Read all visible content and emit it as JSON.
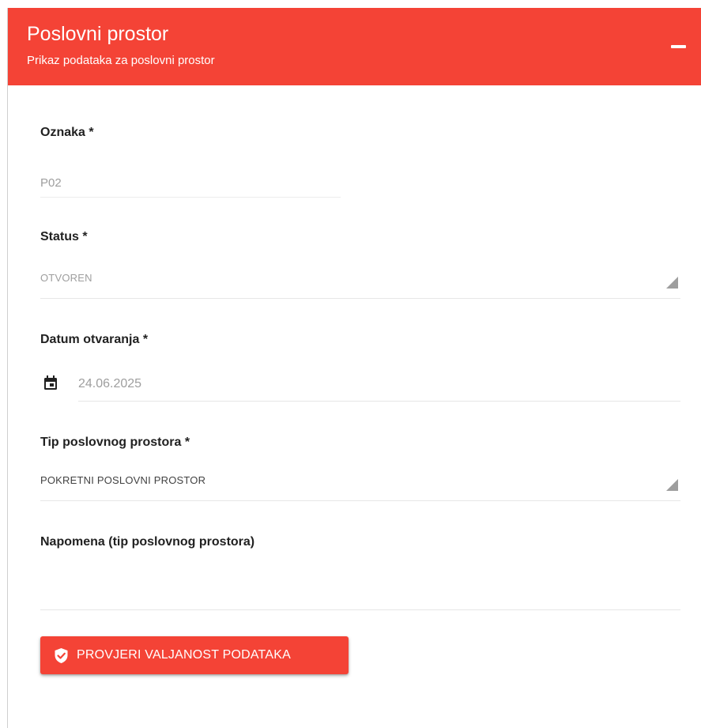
{
  "header": {
    "title": "Poslovni prostor",
    "subtitle": "Prikaz podataka za poslovni prostor",
    "collapse_icon": "minus-icon"
  },
  "form": {
    "oznaka": {
      "label": "Oznaka *",
      "value": "P02"
    },
    "status": {
      "label": "Status *",
      "value": "OTVOREN"
    },
    "datum_otvaranja": {
      "label": "Datum otvaranja *",
      "value": "24.06.2025",
      "icon": "calendar-icon"
    },
    "tip_poslovnog_prostora": {
      "label": "Tip poslovnog prostora *",
      "value": "POKRETNI POSLOVNI PROSTOR"
    },
    "napomena": {
      "label": "Napomena (tip poslovnog prostora)",
      "value": ""
    }
  },
  "actions": {
    "validate_label": "PROVJERI VALJANOST PODATAKA",
    "validate_icon": "shield-check-icon"
  },
  "colors": {
    "accent": "#f44336",
    "header_text": "#ffffff",
    "label_text": "#212121",
    "value_text": "#9e9e9e"
  }
}
